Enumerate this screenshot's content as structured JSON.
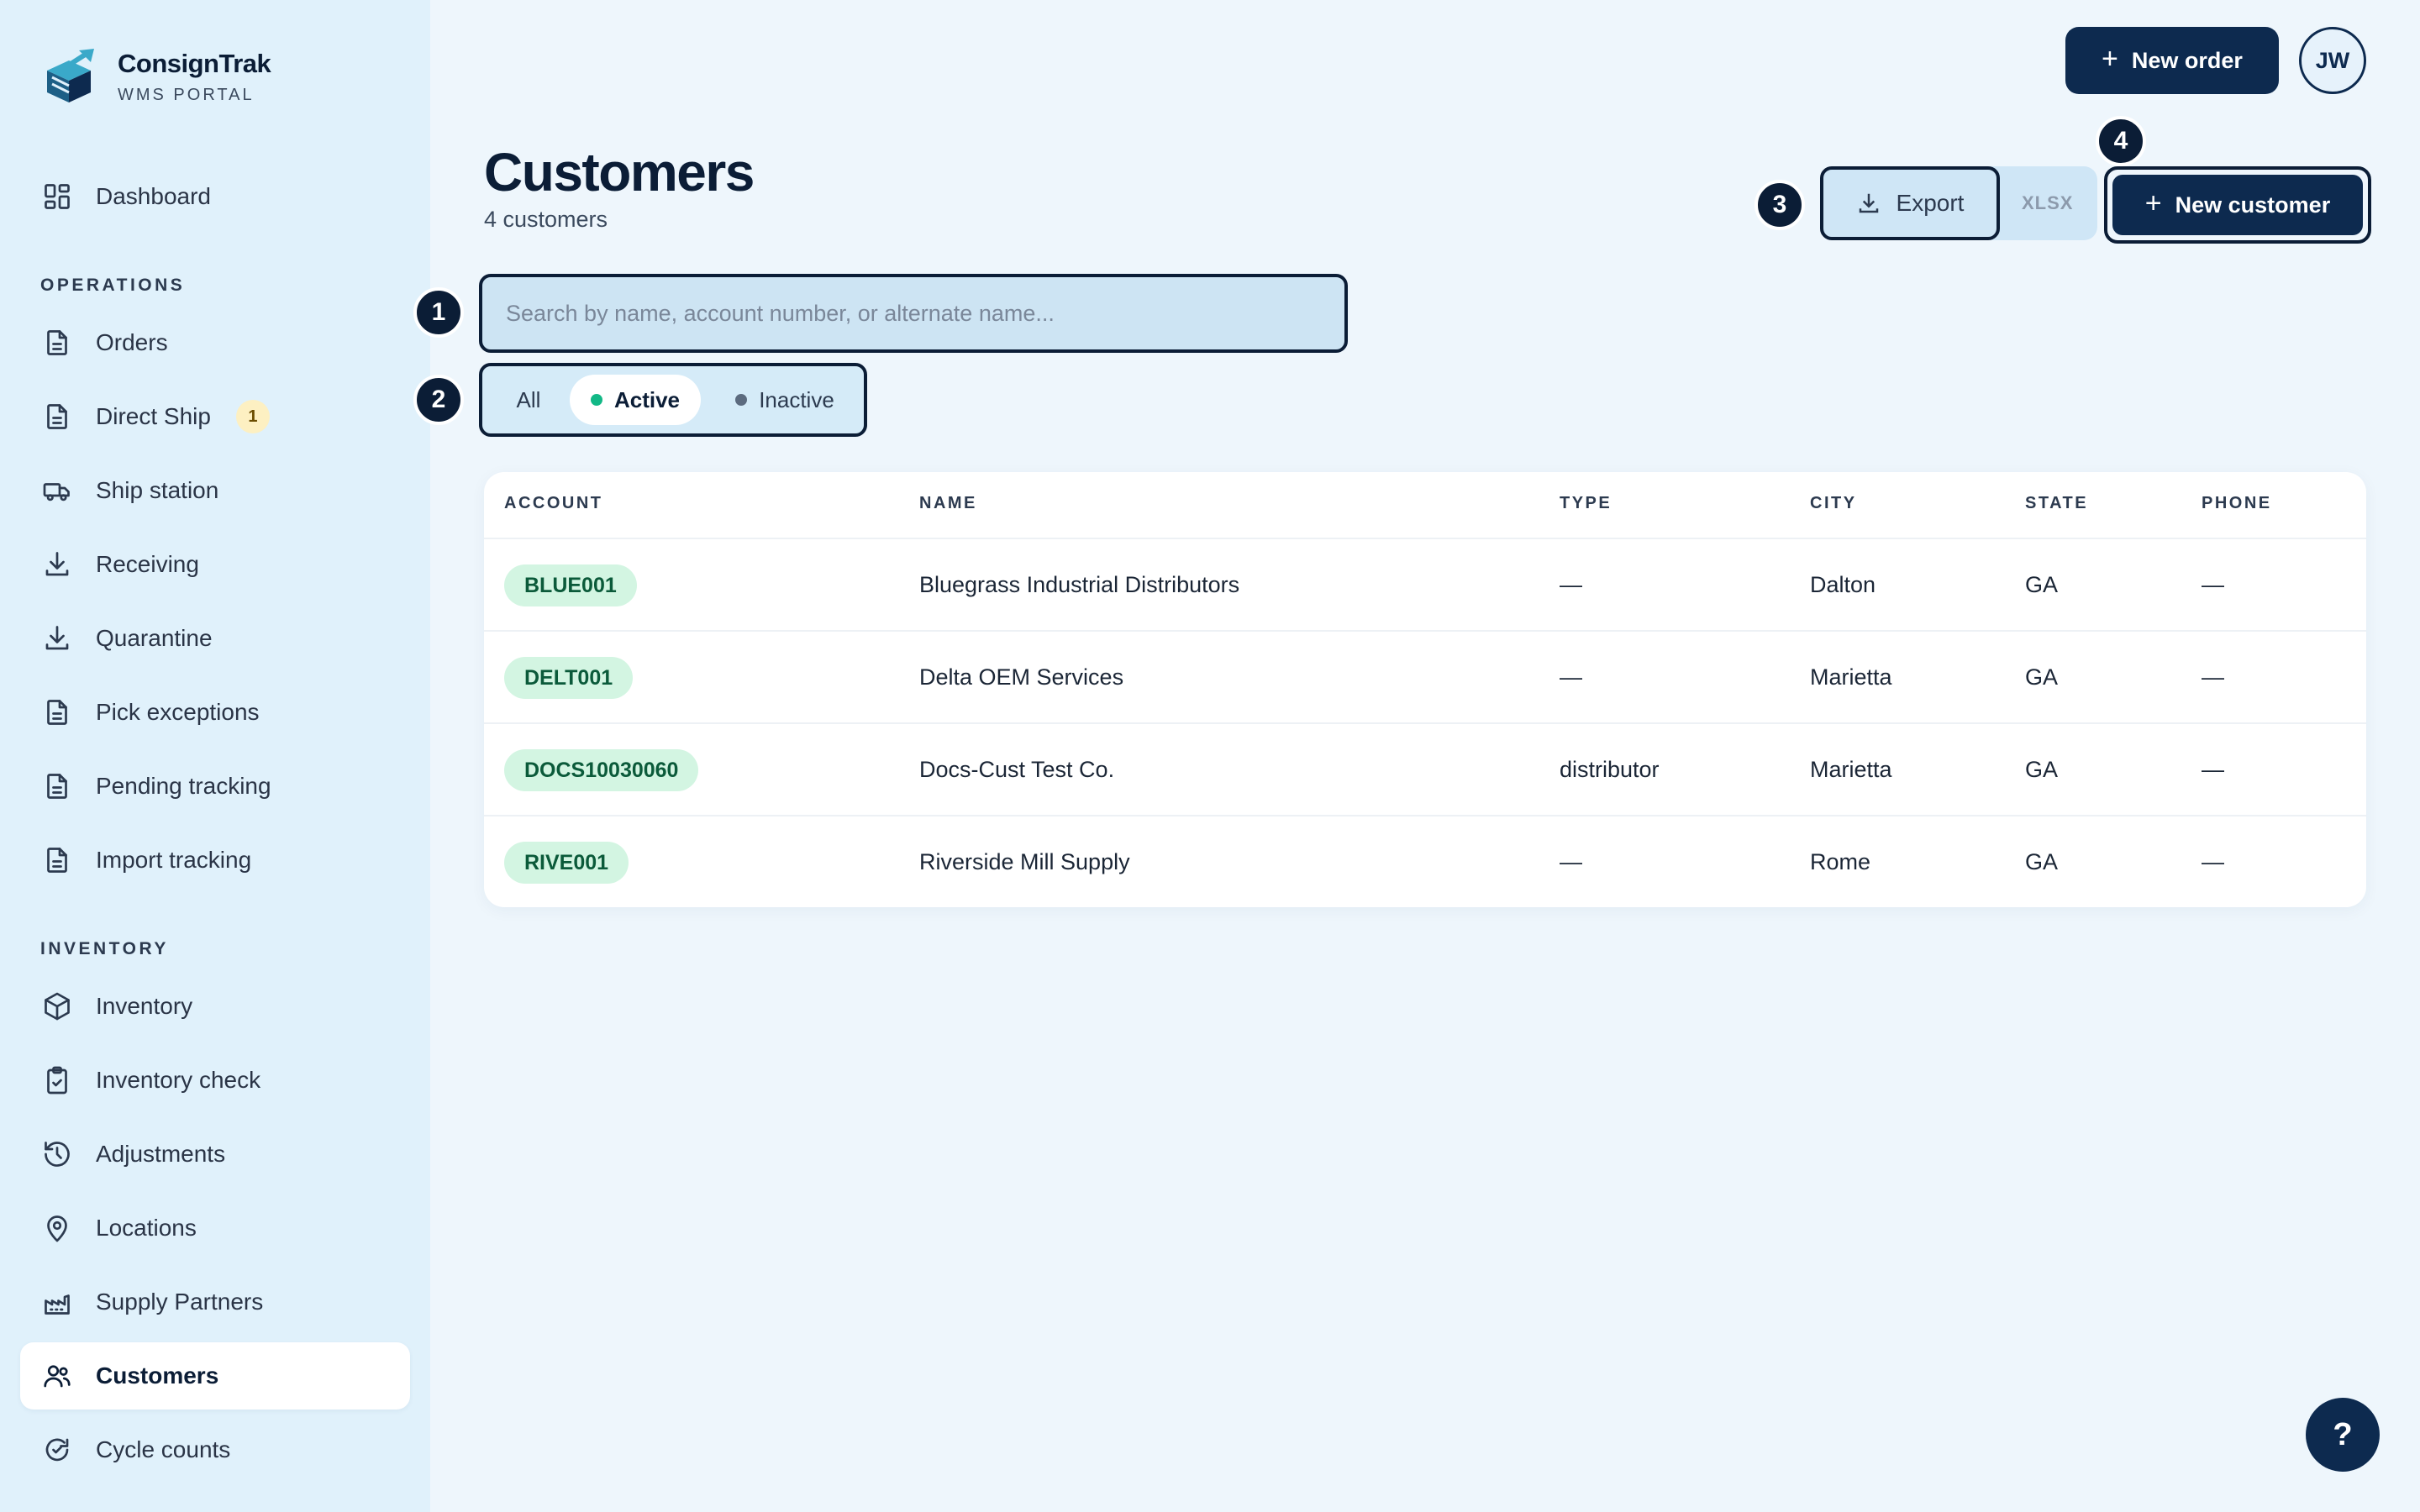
{
  "brand": {
    "name": "ConsignTrak",
    "subtitle": "WMS PORTAL"
  },
  "sidebar": {
    "top_items": [
      {
        "label": "Dashboard",
        "icon": "dashboard-icon"
      }
    ],
    "sections": [
      {
        "title": "OPERATIONS",
        "items": [
          {
            "label": "Orders",
            "icon": "document-icon"
          },
          {
            "label": "Direct Ship",
            "icon": "document-icon",
            "badge": "1"
          },
          {
            "label": "Ship station",
            "icon": "truck-icon"
          },
          {
            "label": "Receiving",
            "icon": "download-icon"
          },
          {
            "label": "Quarantine",
            "icon": "download-icon"
          },
          {
            "label": "Pick exceptions",
            "icon": "document-icon"
          },
          {
            "label": "Pending tracking",
            "icon": "document-icon"
          },
          {
            "label": "Import tracking",
            "icon": "document-icon"
          }
        ]
      },
      {
        "title": "INVENTORY",
        "items": [
          {
            "label": "Inventory",
            "icon": "box-icon"
          },
          {
            "label": "Inventory check",
            "icon": "clipboard-check-icon"
          },
          {
            "label": "Adjustments",
            "icon": "history-icon"
          },
          {
            "label": "Locations",
            "icon": "map-pin-icon"
          },
          {
            "label": "Supply Partners",
            "icon": "factory-icon"
          },
          {
            "label": "Customers",
            "icon": "users-icon",
            "active": true
          },
          {
            "label": "Cycle counts",
            "icon": "refresh-check-icon"
          }
        ]
      }
    ]
  },
  "header": {
    "new_order_label": "New order",
    "avatar_initials": "JW"
  },
  "page": {
    "title": "Customers",
    "subtitle": "4 customers",
    "export_label": "Export",
    "export_format": "XLSX",
    "new_customer_label": "New customer",
    "search_placeholder": "Search by name, account number, or alternate name...",
    "filters": [
      {
        "label": "All",
        "selected": false
      },
      {
        "label": "Active",
        "selected": true,
        "dot_color": "#12b886"
      },
      {
        "label": "Inactive",
        "selected": false,
        "dot_color": "#5c6b7f"
      }
    ],
    "markers": [
      "1",
      "2",
      "3",
      "4"
    ]
  },
  "table": {
    "columns": [
      "ACCOUNT",
      "NAME",
      "TYPE",
      "CITY",
      "STATE",
      "PHONE"
    ],
    "rows": [
      {
        "account": "BLUE001",
        "name": "Bluegrass Industrial Distributors",
        "type": "—",
        "city": "Dalton",
        "state": "GA",
        "phone": "—"
      },
      {
        "account": "DELT001",
        "name": "Delta OEM Services",
        "type": "—",
        "city": "Marietta",
        "state": "GA",
        "phone": "—"
      },
      {
        "account": "DOCS10030060",
        "name": "Docs-Cust Test Co.",
        "type": "distributor",
        "city": "Marietta",
        "state": "GA",
        "phone": "—"
      },
      {
        "account": "RIVE001",
        "name": "Riverside Mill Supply",
        "type": "—",
        "city": "Rome",
        "state": "GA",
        "phone": "—"
      }
    ]
  },
  "help_label": "?",
  "colors": {
    "primary": "#0d2a4f",
    "accent_green": "#12b886",
    "sidebar_bg": "#e0f1fb"
  }
}
